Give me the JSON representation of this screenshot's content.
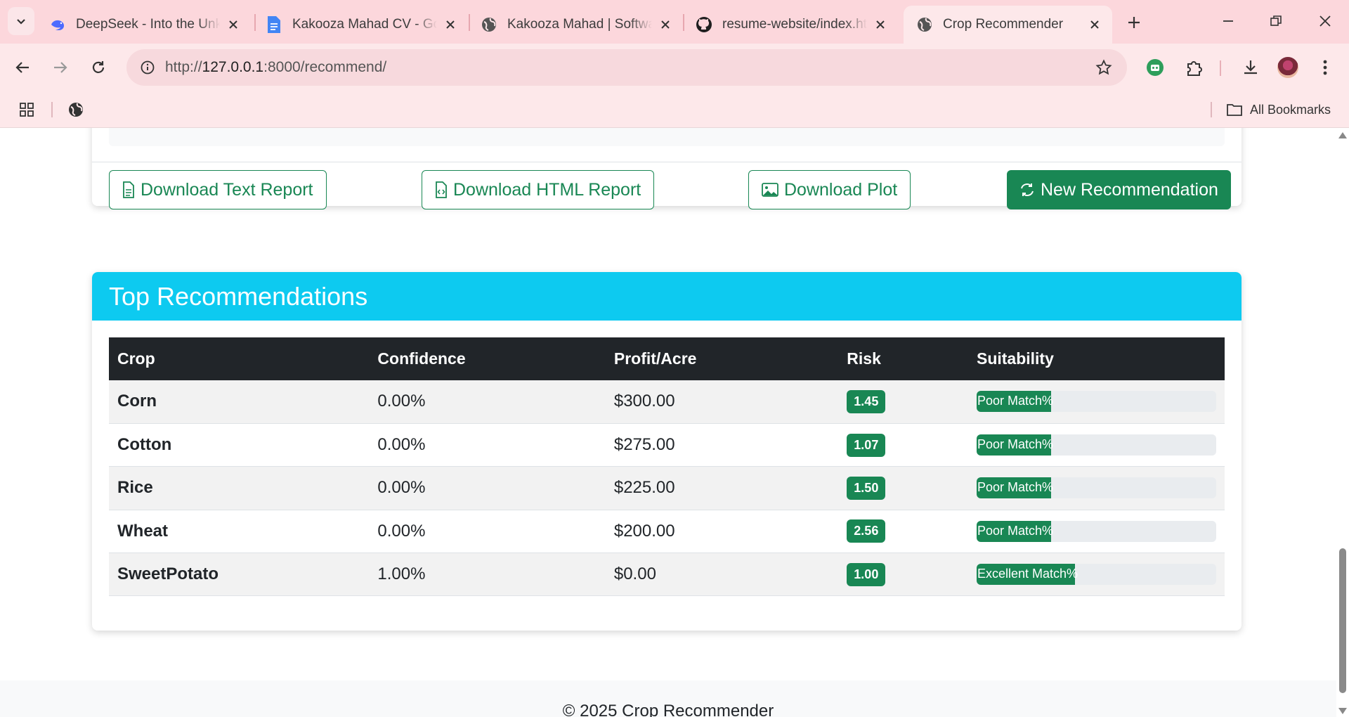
{
  "browser": {
    "tabs": [
      {
        "title": "DeepSeek - Into the Unknown",
        "favicon": "deepseek-whale-icon"
      },
      {
        "title": "Kakooza Mahad CV - Google Docs",
        "favicon": "google-docs-icon"
      },
      {
        "title": "Kakooza Mahad | Software Engineer",
        "favicon": "globe-icon"
      },
      {
        "title": "resume-website/index.html",
        "favicon": "github-icon"
      },
      {
        "title": "Crop Recommender",
        "favicon": "globe-icon",
        "active": true
      }
    ],
    "url": {
      "scheme": "http://",
      "host": "127.0.0.1",
      "path": ":8000/recommend/"
    },
    "bookmarks": {
      "all_label": "All Bookmarks"
    }
  },
  "actions": {
    "download_text": "Download Text Report",
    "download_html": "Download HTML Report",
    "download_plot": "Download Plot",
    "new_recommendation": "New Recommendation"
  },
  "recommendations": {
    "title": "Top Recommendations",
    "columns": [
      "Crop",
      "Confidence",
      "Profit/Acre",
      "Risk",
      "Suitability"
    ],
    "rows": [
      {
        "crop": "Corn",
        "confidence": "0.00%",
        "profit": "$300.00",
        "risk": "1.45",
        "suitability": "Poor Match%",
        "suitability_fill_pct": 31
      },
      {
        "crop": "Cotton",
        "confidence": "0.00%",
        "profit": "$275.00",
        "risk": "1.07",
        "suitability": "Poor Match%",
        "suitability_fill_pct": 31
      },
      {
        "crop": "Rice",
        "confidence": "0.00%",
        "profit": "$225.00",
        "risk": "1.50",
        "suitability": "Poor Match%",
        "suitability_fill_pct": 31
      },
      {
        "crop": "Wheat",
        "confidence": "0.00%",
        "profit": "$200.00",
        "risk": "2.56",
        "suitability": "Poor Match%",
        "suitability_fill_pct": 31
      },
      {
        "crop": "SweetPotato",
        "confidence": "1.00%",
        "profit": "$0.00",
        "risk": "1.00",
        "suitability": "Excellent Match%",
        "suitability_fill_pct": 41
      }
    ]
  },
  "footer": {
    "text": "© 2025 Crop Recommender"
  },
  "colors": {
    "success": "#198754",
    "info": "#0dcaf0",
    "dark": "#212529",
    "chrome_pink": "#fcd7dc"
  }
}
